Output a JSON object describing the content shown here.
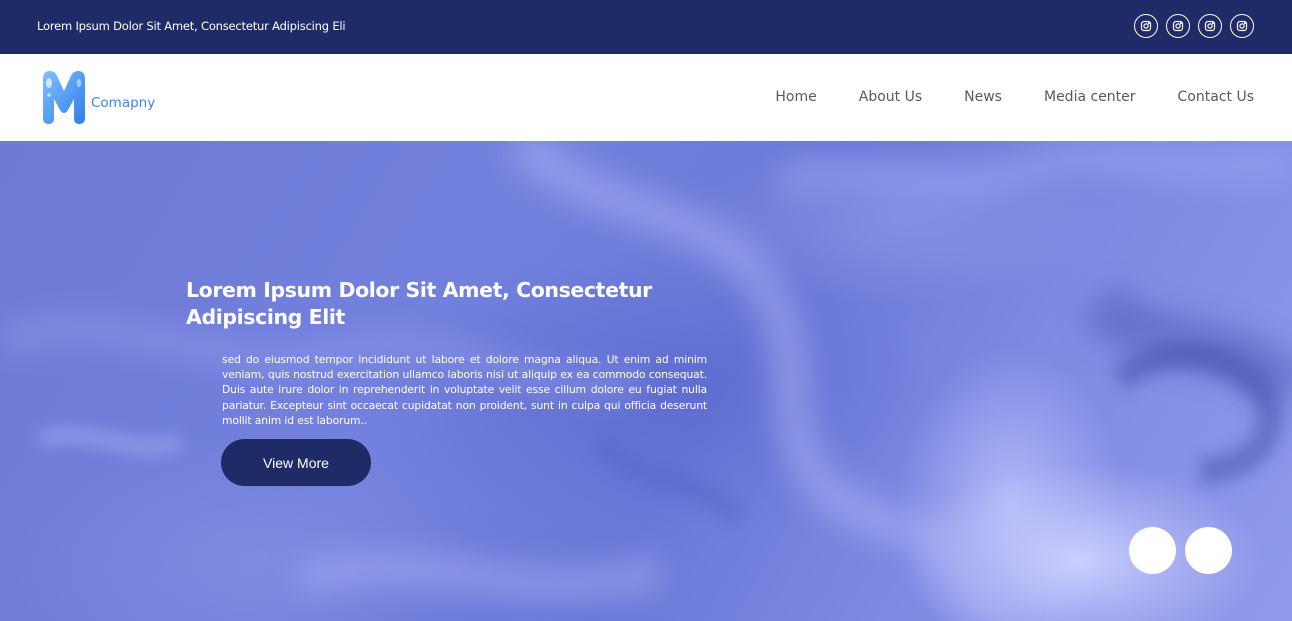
{
  "topbar": {
    "text": "Lorem Ipsum Dolor Sit Amet, Consectetur Adipiscing Eli",
    "social_icons": [
      "instagram-icon",
      "instagram-icon",
      "instagram-icon",
      "instagram-icon"
    ]
  },
  "header": {
    "logo_letter_icon": "m-logo-icon",
    "logo_text": "Comapny",
    "nav": [
      {
        "label": "Home"
      },
      {
        "label": "About Us"
      },
      {
        "label": "News"
      },
      {
        "label": "Media center"
      },
      {
        "label": "Contact Us"
      }
    ]
  },
  "hero": {
    "title": "Lorem Ipsum Dolor Sit Amet, Consectetur Adipiscing Elit",
    "text": "sed do eiusmod tempor incididunt ut labore et dolore magna aliqua. Ut enim ad minim veniam, quis nostrud exercitation ullamco laboris nisi ut aliquip ex ea commodo consequat. Duis aute irure dolor in reprehenderit in voluptate velit esse cillum dolore eu fugiat nulla pariatur. Excepteur sint occaecat cupidatat non proident, sunt in culpa qui officia deserunt mollit anim id est laborum..",
    "button_label": "View More"
  },
  "colors": {
    "topbar_bg": "#1f2b66",
    "button_bg": "#1f2b66",
    "logo_blue": "#3b86e6",
    "nav_text": "#555a63",
    "hero_tint": "#7381de"
  }
}
